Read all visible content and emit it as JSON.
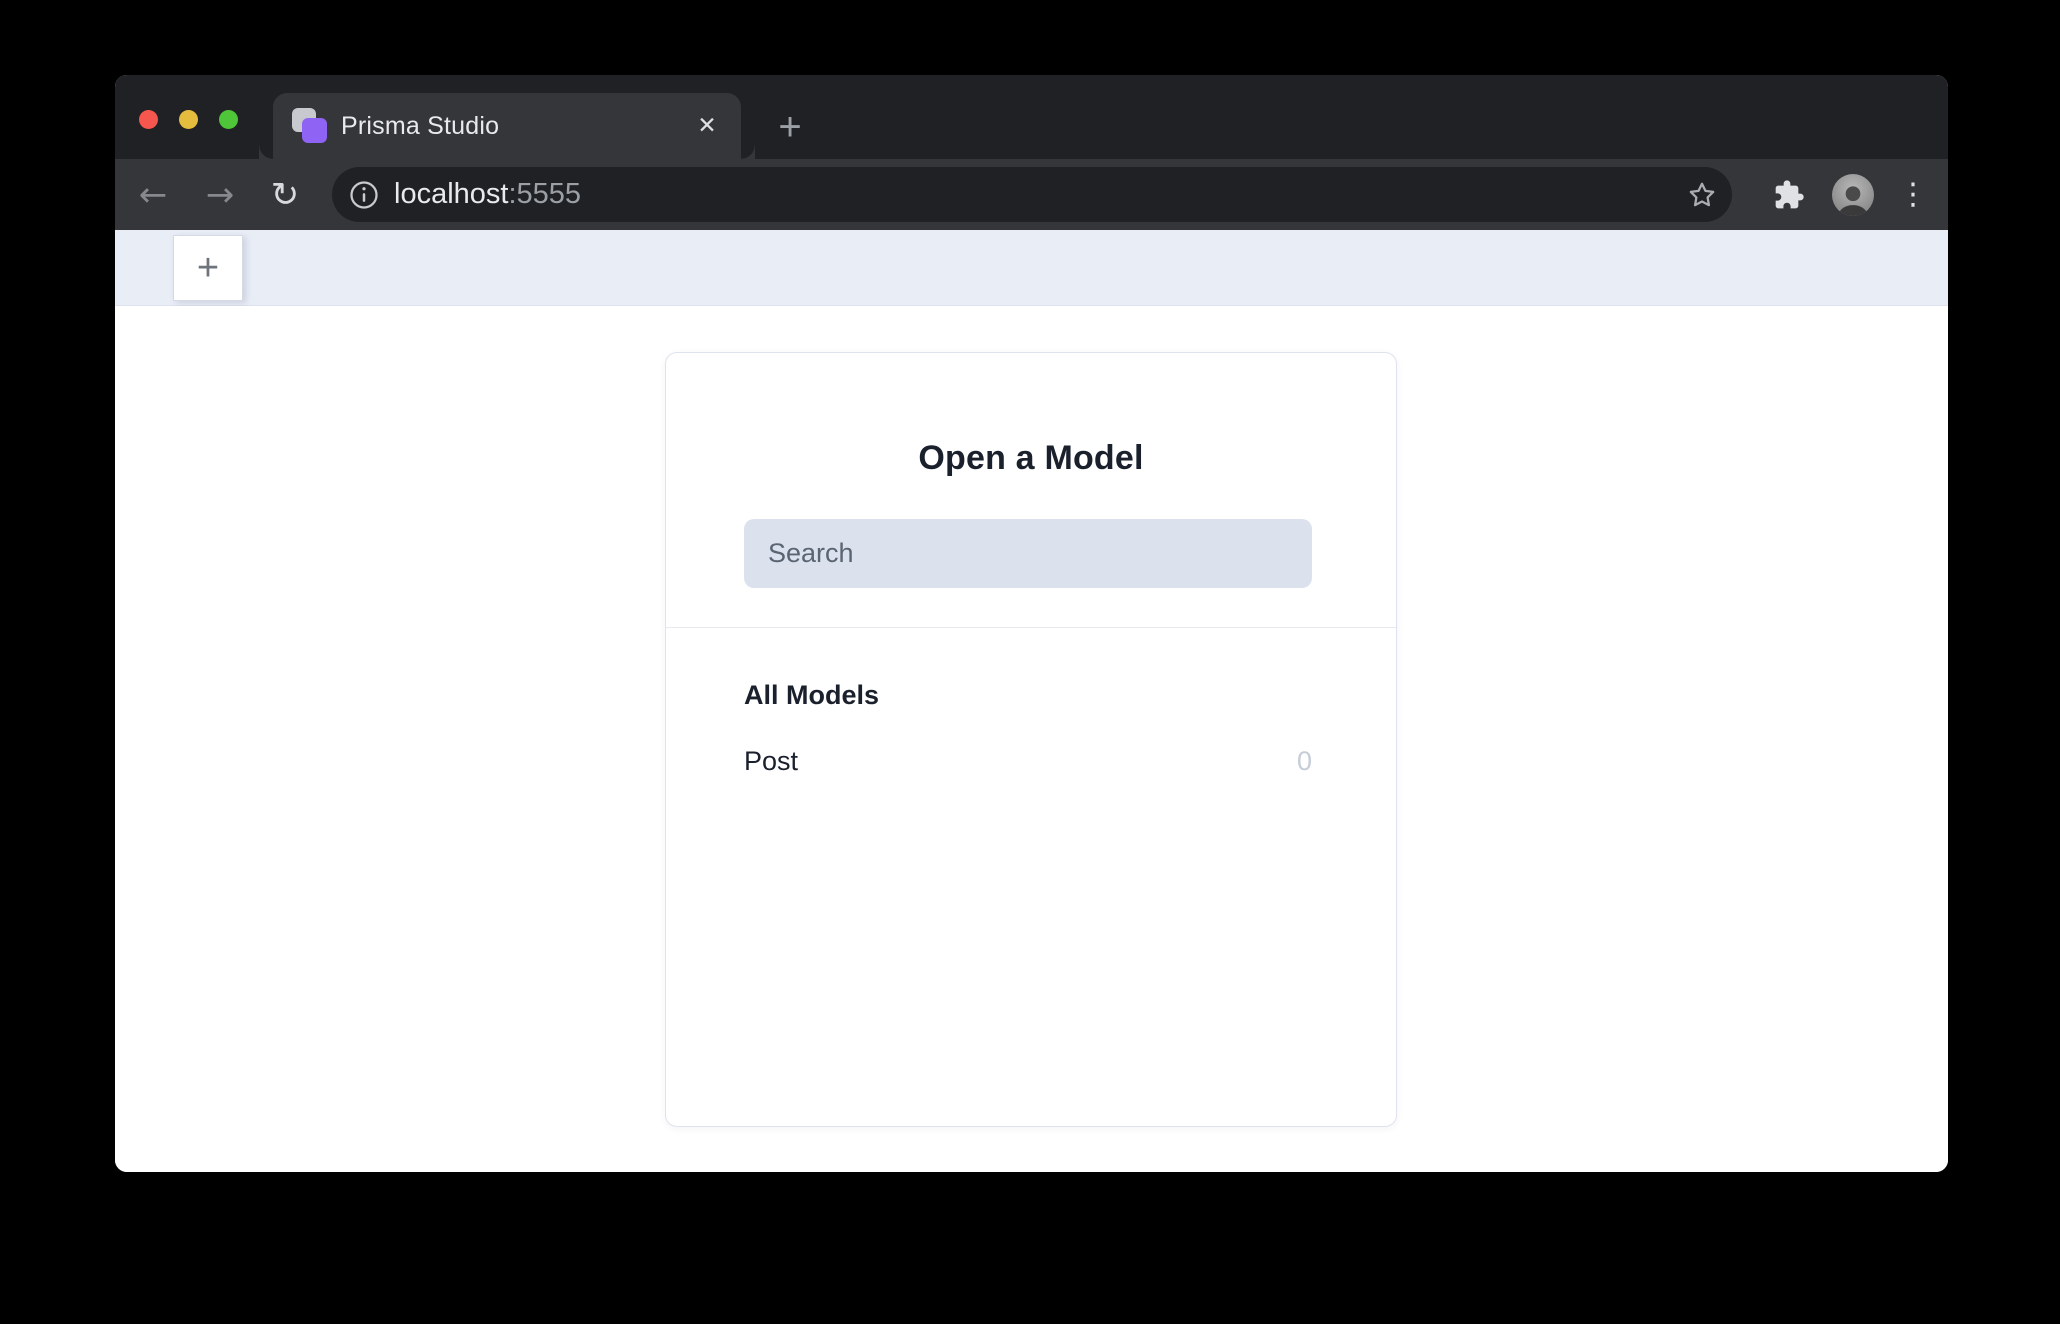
{
  "browser": {
    "traffic_lights": {
      "close_color": "#f5564e",
      "minimize_color": "#e5bd3e",
      "maximize_color": "#4fc53a"
    },
    "tab": {
      "title": "Prisma Studio",
      "close_glyph": "✕"
    },
    "new_tab_glyph": "+",
    "toolbar": {
      "back_glyph": "←",
      "forward_glyph": "→",
      "reload_glyph": "↻",
      "url": {
        "host": "localhost",
        "port": ":5555"
      },
      "menu_glyph": "⋮",
      "icons": [
        "info-icon",
        "bookmark-star-icon",
        "extensions-puzzle-icon",
        "profile-avatar",
        "menu-dots-icon"
      ]
    }
  },
  "studio": {
    "new_tab_glyph": "+",
    "dialog": {
      "title": "Open a Model",
      "search_placeholder": "Search",
      "section_title": "All Models",
      "models": [
        {
          "name": "Post",
          "count": "0"
        }
      ]
    }
  },
  "colors": {
    "chrome_dark": "#202124",
    "chrome_light": "#35363a",
    "accent_purple": "#8f63f3",
    "studio_strip_bg": "#e9edf6",
    "search_input_bg": "#dbe2ee",
    "card_border": "#dfe3ee",
    "count_muted": "#c6cdd8"
  }
}
